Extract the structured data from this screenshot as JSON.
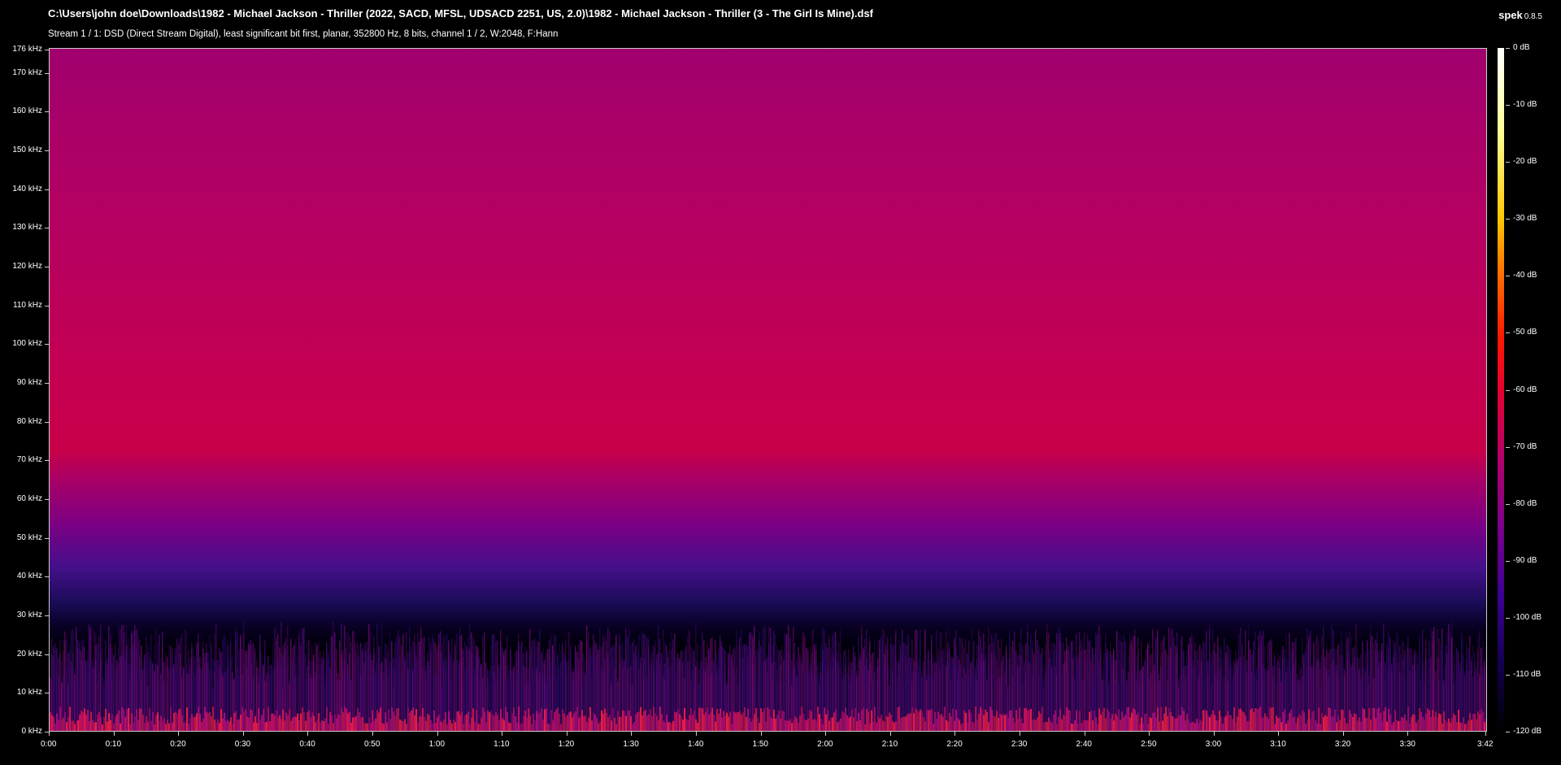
{
  "header": {
    "file_path": "C:\\Users\\john doe\\Downloads\\1982 - Michael Jackson - Thriller (2022, SACD, MFSL, UDSACD 2251, US, 2.0)\\1982 - Michael Jackson - Thriller (3 - The Girl Is Mine).dsf",
    "stream_info": "Stream 1 / 1: DSD (Direct Stream Digital), least significant bit first, planar, 352800 Hz, 8 bits, channel 1 / 2, W:2048, F:Hann",
    "app_name": "spek",
    "app_version": "0.8.5"
  },
  "frequency_axis": {
    "labels": [
      "176 kHz",
      "170 kHz",
      "160 kHz",
      "150 kHz",
      "140 kHz",
      "130 kHz",
      "120 kHz",
      "110 kHz",
      "100 kHz",
      "90 kHz",
      "80 kHz",
      "70 kHz",
      "60 kHz",
      "50 kHz",
      "40 kHz",
      "30 kHz",
      "20 kHz",
      "10 kHz",
      "0 kHz"
    ],
    "values_khz": [
      176,
      170,
      160,
      150,
      140,
      130,
      120,
      110,
      100,
      90,
      80,
      70,
      60,
      50,
      40,
      30,
      20,
      10,
      0
    ],
    "max_khz": 176.4
  },
  "time_axis": {
    "labels": [
      "0:00",
      "0:10",
      "0:20",
      "0:30",
      "0:40",
      "0:50",
      "1:00",
      "1:10",
      "1:20",
      "1:30",
      "1:40",
      "1:50",
      "2:00",
      "2:10",
      "2:20",
      "2:30",
      "2:40",
      "2:50",
      "3:00",
      "3:10",
      "3:20",
      "3:30",
      "3:42"
    ],
    "values_s": [
      0,
      10,
      20,
      30,
      40,
      50,
      60,
      70,
      80,
      90,
      100,
      110,
      120,
      130,
      140,
      150,
      160,
      170,
      180,
      190,
      200,
      210,
      222
    ],
    "duration_s": 222
  },
  "db_scale": {
    "labels": [
      "0 dB",
      "-10 dB",
      "-20 dB",
      "-30 dB",
      "-40 dB",
      "-50 dB",
      "-60 dB",
      "-70 dB",
      "-80 dB",
      "-90 dB",
      "-100 dB",
      "-110 dB",
      "-120 dB"
    ],
    "values_db": [
      0,
      -10,
      -20,
      -30,
      -40,
      -50,
      -60,
      -70,
      -80,
      -90,
      -100,
      -110,
      -120
    ],
    "min_db": -120
  },
  "colors": {
    "background": "#000000",
    "text": "#ffffff",
    "plot_border": "#cccccc"
  }
}
